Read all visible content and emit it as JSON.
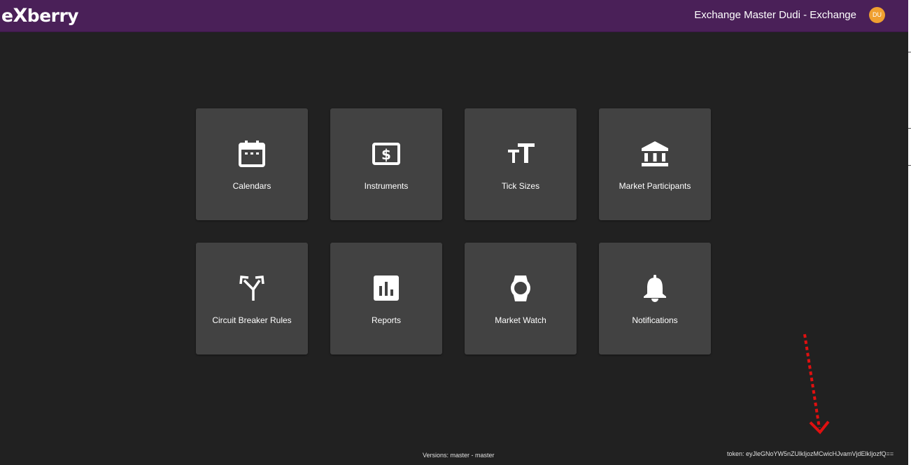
{
  "header": {
    "logo_text": "eXberry",
    "user_name": "Exchange Master Dudi - Exchange",
    "avatar_initials": "DU",
    "background_color": "#4a2058",
    "avatar_color": "#f0a030"
  },
  "tiles": [
    {
      "label": "Calendars",
      "icon": "calendar-icon"
    },
    {
      "label": "Instruments",
      "icon": "dollar-bill-icon"
    },
    {
      "label": "Tick Sizes",
      "icon": "text-size-icon"
    },
    {
      "label": "Market Participants",
      "icon": "bank-icon"
    },
    {
      "label": "Circuit Breaker Rules",
      "icon": "split-arrows-icon"
    },
    {
      "label": "Reports",
      "icon": "bar-chart-icon"
    },
    {
      "label": "Market Watch",
      "icon": "watch-icon"
    },
    {
      "label": "Notifications",
      "icon": "bell-icon"
    }
  ],
  "footer": {
    "versions": "Versions: master - master",
    "token": "token: eyJleGNoYW5nZUlkIjozMCwicHJvamVjdElkIjozfQ=="
  },
  "theme": {
    "background": "#212121",
    "tile": "#424242",
    "annotation": "#e01010"
  }
}
